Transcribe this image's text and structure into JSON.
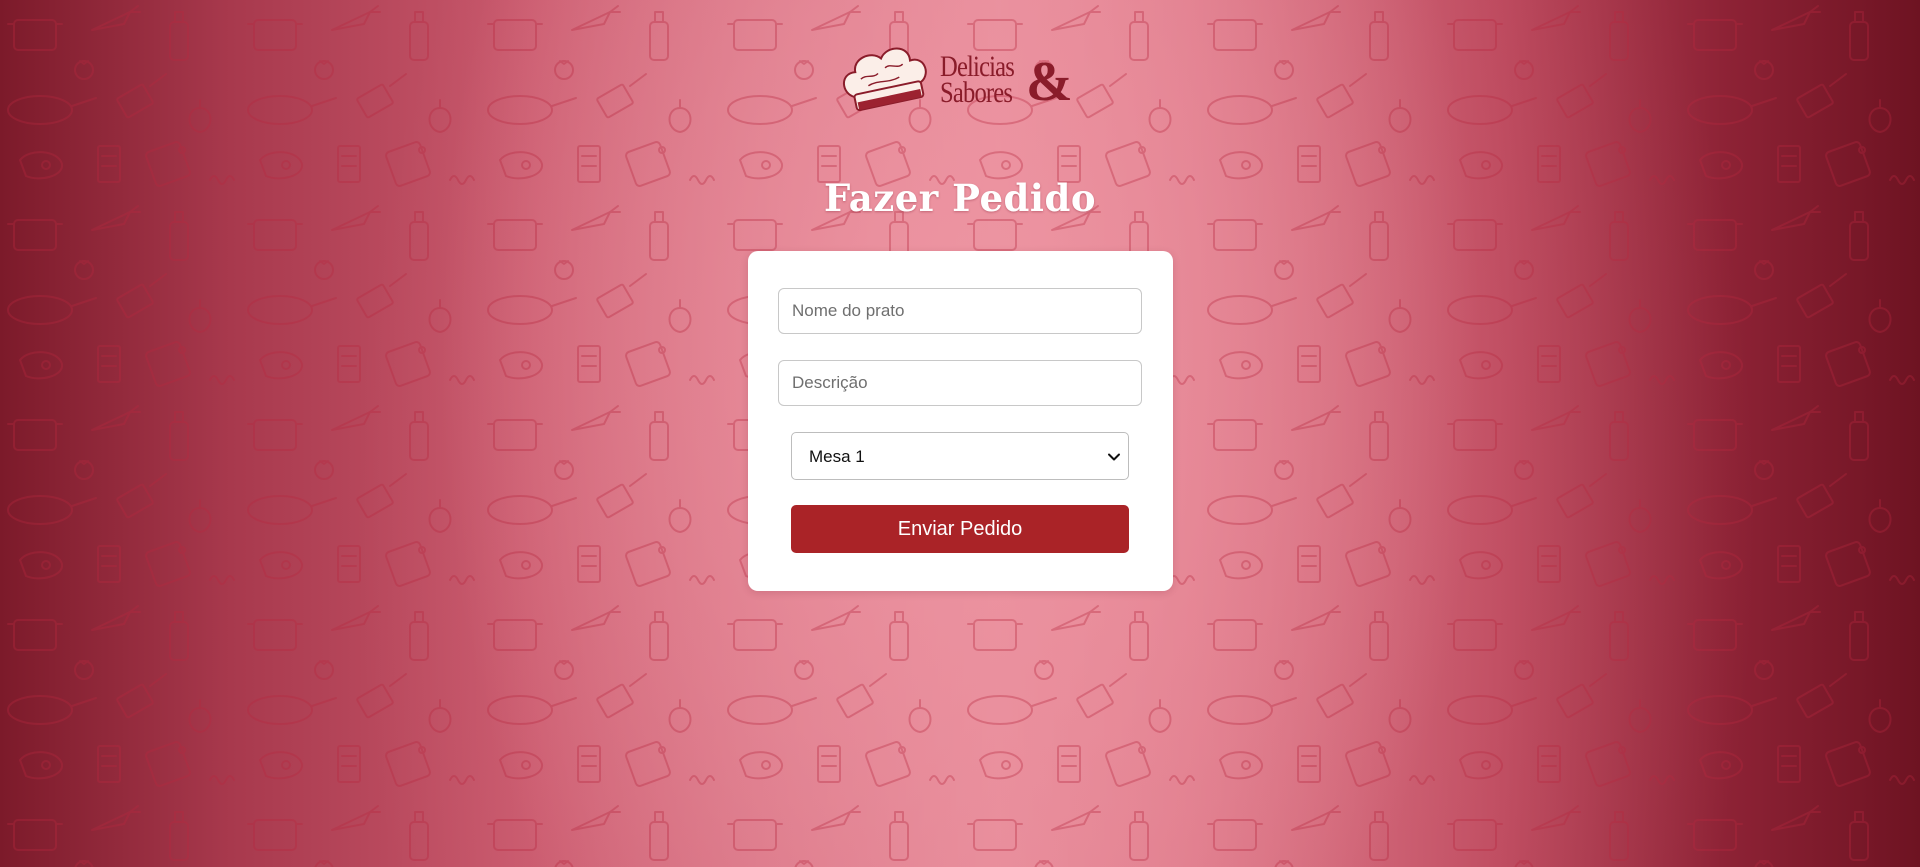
{
  "brand": {
    "line1": "Delicias",
    "line2": "Sabores",
    "ampersand": "&",
    "logo_icon": "chef-hat-icon"
  },
  "page": {
    "title": "Fazer Pedido"
  },
  "form": {
    "dish_name_placeholder": "Nome do prato",
    "dish_name_value": "",
    "description_placeholder": "Descrição",
    "description_value": "",
    "table_select": {
      "selected": "Mesa 1",
      "icon": "chevron-down-icon"
    },
    "submit_label": "Enviar Pedido"
  },
  "colors": {
    "accent": "#aa2327",
    "brand_text": "#8a1c2a",
    "background_center": "#e58e9c",
    "background_edge": "#7c1a2a"
  },
  "background_pattern": "kitchen-doodles-icon"
}
